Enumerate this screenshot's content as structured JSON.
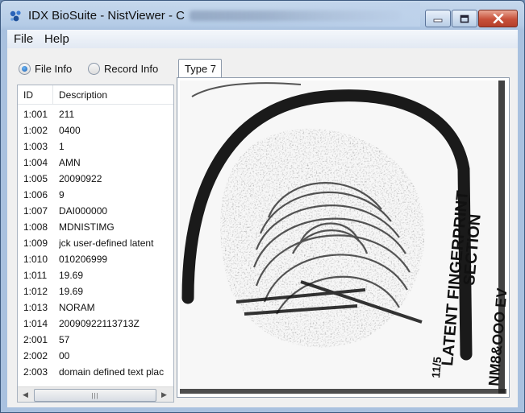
{
  "window": {
    "title": "IDX BioSuite - NistViewer - C",
    "colors": {
      "titlebar": "#b4cbe6",
      "close_button": "#c7503a",
      "accent": "#1f5fb0"
    }
  },
  "menu": {
    "items": [
      "File",
      "Help"
    ]
  },
  "view_options": {
    "file_info_label": "File Info",
    "record_info_label": "Record Info",
    "selected": "File Info"
  },
  "records_table": {
    "columns": [
      "ID",
      "Description"
    ],
    "rows": [
      {
        "id": "1:001",
        "description": "211"
      },
      {
        "id": "1:002",
        "description": "0400"
      },
      {
        "id": "1:003",
        "description": "1"
      },
      {
        "id": "1:004",
        "description": "AMN"
      },
      {
        "id": "1:005",
        "description": "20090922"
      },
      {
        "id": "1:006",
        "description": "9"
      },
      {
        "id": "1:007",
        "description": "DAI000000"
      },
      {
        "id": "1:008",
        "description": "MDNISTIMG"
      },
      {
        "id": "1:009",
        "description": "jck user-defined latent"
      },
      {
        "id": "1:010",
        "description": "010206999"
      },
      {
        "id": "1:011",
        "description": "19.69"
      },
      {
        "id": "1:012",
        "description": "19.69"
      },
      {
        "id": "1:013",
        "description": "NORAM"
      },
      {
        "id": "1:014",
        "description": "20090922113713Z"
      },
      {
        "id": "2:001",
        "description": "57"
      },
      {
        "id": "2:002",
        "description": "00"
      },
      {
        "id": "2:003",
        "description": "domain defined text plac"
      }
    ]
  },
  "tabs": [
    {
      "label": "Type 7",
      "selected": true
    }
  ],
  "image": {
    "card_text_line1": "LATENT FINGERPRINT",
    "card_text_line2": "SECTION",
    "card_text_line3": "NM8&OOO  EV",
    "card_text_line4": "11/5"
  },
  "icons": [
    "app-logo-icon",
    "minimize-icon",
    "maximize-icon",
    "close-icon",
    "scroll-left-icon",
    "scroll-right-icon",
    "scroll-grip-icon"
  ]
}
